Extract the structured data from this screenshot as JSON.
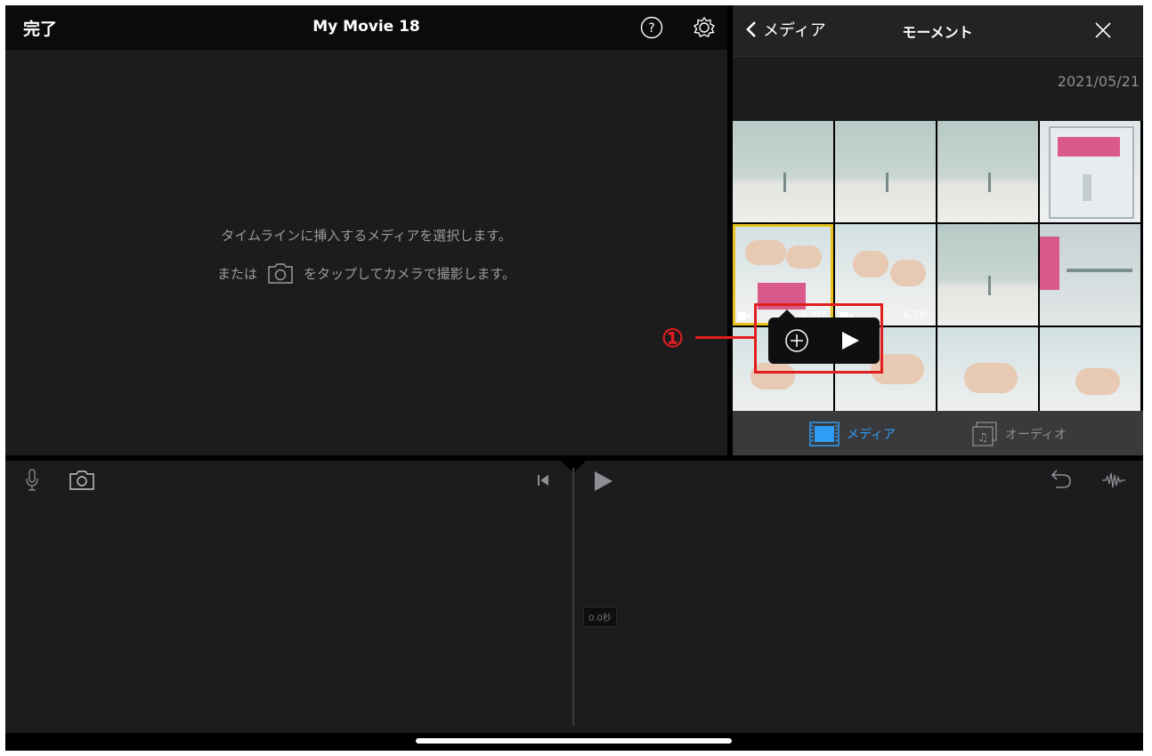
{
  "header": {
    "done_label": "完了",
    "title": "My Movie 18"
  },
  "viewer": {
    "hint_line1": "タイムラインに挿入するメディアを選択します。",
    "hint_line2_prefix": "または",
    "hint_line2_suffix": "をタップしてカメラで撮影します。"
  },
  "media_panel": {
    "back_label": "メディア",
    "title": "モーメント",
    "date": "2021/05/21",
    "thumbnails": [
      {
        "kind": "wall"
      },
      {
        "kind": "wall"
      },
      {
        "kind": "wall"
      },
      {
        "kind": "tray"
      },
      {
        "kind": "hands",
        "selected": true,
        "duration": "6.8秒",
        "video": true
      },
      {
        "kind": "hands",
        "duration": "6.7秒",
        "video": true
      },
      {
        "kind": "wall"
      },
      {
        "kind": "pink"
      },
      {
        "kind": "hands"
      },
      {
        "kind": "hands"
      },
      {
        "kind": "hands"
      },
      {
        "kind": "hands"
      }
    ],
    "tabs": {
      "media_label": "メディア",
      "audio_label": "オーディオ"
    }
  },
  "callout": {
    "number": "①"
  },
  "timeline": {
    "timecode": "0.0秒"
  },
  "colors": {
    "accent": "#2f9cf5",
    "selection": "#e8c21d",
    "callout": "#e21d1d"
  }
}
